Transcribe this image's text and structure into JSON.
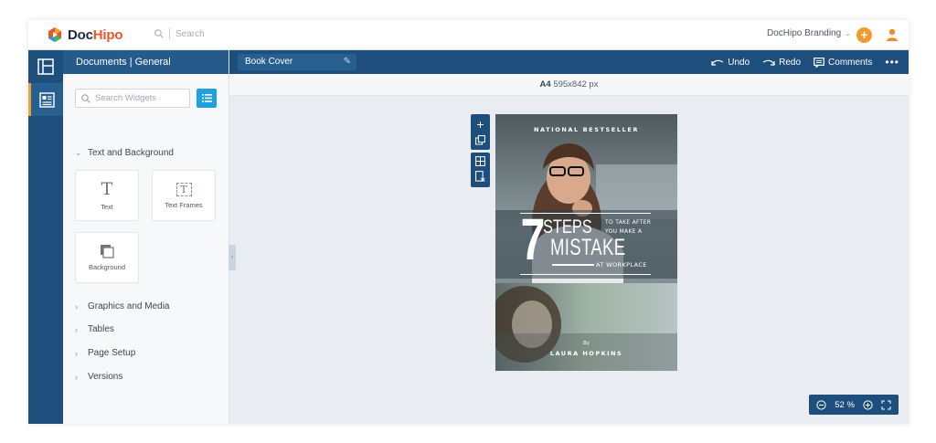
{
  "app": {
    "logo_prefix": "Doc",
    "logo_suffix": "Hipo",
    "search_placeholder": "Search",
    "brand_name": "DocHipo Branding",
    "colors": {
      "primary": "#1e4f7c",
      "accent": "#f39a2c",
      "info": "#1fa1e0"
    }
  },
  "rail": {
    "items": [
      {
        "icon": "layout-icon"
      },
      {
        "icon": "widgets-icon"
      }
    ]
  },
  "panel": {
    "breadcrumb": "Documents | General",
    "widget_search_placeholder": "Search Widgets",
    "sections": [
      {
        "label": "Text and Background",
        "expanded": true
      },
      {
        "label": "Graphics and Media",
        "expanded": false
      },
      {
        "label": "Tables",
        "expanded": false
      },
      {
        "label": "Page Setup",
        "expanded": false
      },
      {
        "label": "Versions",
        "expanded": false
      }
    ],
    "tiles": [
      {
        "label": "Text",
        "icon": "text-icon"
      },
      {
        "label": "Text Frames",
        "icon": "text-frame-icon"
      },
      {
        "label": "Background",
        "icon": "background-icon"
      }
    ]
  },
  "editor": {
    "document_name": "Book Cover",
    "actions": {
      "undo": "Undo",
      "redo": "Redo",
      "comments": "Comments"
    },
    "page_size_name": "A4",
    "page_size_dims": "595x842 px",
    "zoom": {
      "value": "52",
      "unit": "%"
    }
  },
  "cover": {
    "top_tagline": "NATIONAL BESTSELLER",
    "number": "7",
    "steps": "STEPS",
    "line1": "TO TAKE AFTER",
    "line2": "YOU MAKE A",
    "mistake": "MISTAKE",
    "at_workplace": "AT WORKPLACE",
    "by": "By",
    "author": "LAURA HOPKINS"
  }
}
